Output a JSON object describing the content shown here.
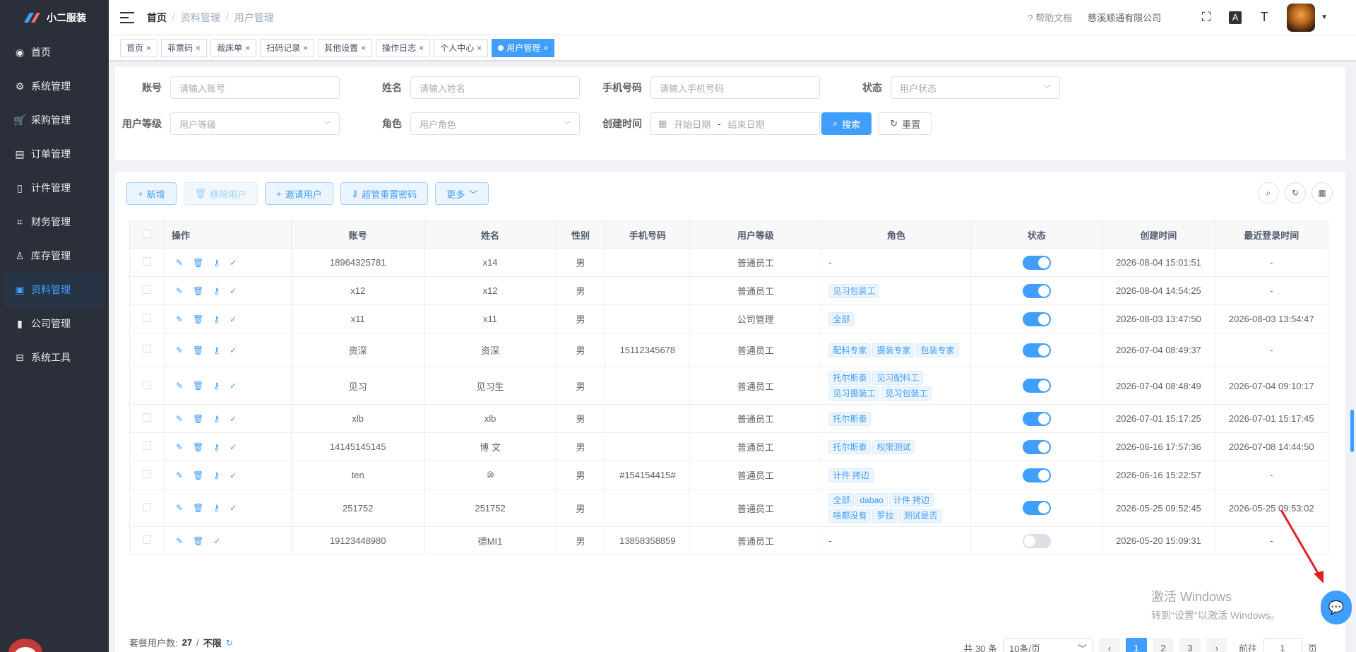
{
  "app": {
    "title": "小二服装"
  },
  "sidebar": {
    "items": [
      {
        "label": "首页",
        "icon": "dashboard-icon"
      },
      {
        "label": "系统管理",
        "icon": "gear-icon"
      },
      {
        "label": "采购管理",
        "icon": "cart-icon"
      },
      {
        "label": "订单管理",
        "icon": "order-icon"
      },
      {
        "label": "计件管理",
        "icon": "book-icon"
      },
      {
        "label": "财务管理",
        "icon": "finance-icon"
      },
      {
        "label": "库存管理",
        "icon": "user-icon"
      },
      {
        "label": "资料管理",
        "icon": "document-icon"
      },
      {
        "label": "公司管理",
        "icon": "chart-icon"
      },
      {
        "label": "系统工具",
        "icon": "toolbox-icon"
      }
    ]
  },
  "navbar": {
    "breadcrumb": [
      "首页",
      "资料管理",
      "用户管理"
    ],
    "help": "帮助文档",
    "company": "慈溪顺通有限公司"
  },
  "tags": [
    {
      "label": "首页"
    },
    {
      "label": "菲票码"
    },
    {
      "label": "裁床单"
    },
    {
      "label": "扫码记录"
    },
    {
      "label": "其他设置"
    },
    {
      "label": "操作日志"
    },
    {
      "label": "个人中心"
    },
    {
      "label": "用户管理"
    }
  ],
  "search": {
    "account_label": "账号",
    "account_placeholder": "请输入账号",
    "name_label": "姓名",
    "name_placeholder": "请输入姓名",
    "phone_label": "手机号码",
    "phone_placeholder": "请输入手机号码",
    "status_label": "状态",
    "status_placeholder": "用户状态",
    "level_label": "用户等级",
    "level_placeholder": "用户等级",
    "role_label": "角色",
    "role_placeholder": "用户角色",
    "created_label": "创建时间",
    "start_placeholder": "开始日期",
    "end_placeholder": "结束日期",
    "range_sep": "-",
    "search_btn": "搜索",
    "reset_btn": "重置"
  },
  "toolbar": {
    "add": "新增",
    "remove": "移除用户",
    "invite": "邀请用户",
    "reset_pwd": "超管重置密码",
    "more": "更多"
  },
  "table": {
    "headers": [
      "操作",
      "账号",
      "姓名",
      "性别",
      "手机号码",
      "用户等级",
      "角色",
      "状态",
      "创建时间",
      "最近登录时间"
    ],
    "rows": [
      {
        "account": "18964325781",
        "name": "x14",
        "gender": "男",
        "phone": "",
        "level": "普通员工",
        "roles": [],
        "role_text": "-",
        "on": true,
        "created": "2026-08-04 15:01:51",
        "last": "-"
      },
      {
        "account": "x12",
        "name": "x12",
        "gender": "男",
        "phone": "",
        "level": "普通员工",
        "roles": [
          "见习包装工"
        ],
        "on": true,
        "created": "2026-08-04 14:54:25",
        "last": "-"
      },
      {
        "account": "x11",
        "name": "x11",
        "gender": "男",
        "phone": "",
        "level": "公司管理",
        "roles": [
          "全部"
        ],
        "on": true,
        "created": "2026-08-03 13:47:50",
        "last": "2026-08-03 13:54:47"
      },
      {
        "account": "资深",
        "name": "资深",
        "gender": "男",
        "phone": "15112345678",
        "level": "普通员工",
        "roles": [
          "配料专家",
          "摄装专家",
          "包装专家"
        ],
        "on": true,
        "created": "2026-07-04 08:49:37",
        "last": "-"
      },
      {
        "account": "见习",
        "name": "见习生",
        "gender": "男",
        "phone": "",
        "level": "普通员工",
        "roles": [
          "托尔斯泰",
          "见习配料工",
          "见习摄装工",
          "见习包装工"
        ],
        "on": true,
        "created": "2026-07-04 08:48:49",
        "last": "2026-07-04 09:10:17"
      },
      {
        "account": "xlb",
        "name": "xlb",
        "gender": "男",
        "phone": "",
        "level": "普通员工",
        "roles": [
          "托尔斯泰"
        ],
        "on": true,
        "created": "2026-07-01 15:17:25",
        "last": "2026-07-01 15:17:45"
      },
      {
        "account": "14145145145",
        "name": "博 文",
        "gender": "男",
        "phone": "",
        "level": "普通员工",
        "roles": [
          "托尔斯泰",
          "权限测试"
        ],
        "on": true,
        "created": "2026-06-16 17:57:36",
        "last": "2026-07-08 14:44:50"
      },
      {
        "account": "ten",
        "name": "⑩",
        "gender": "男",
        "phone": "#154154415#",
        "level": "普通员工",
        "roles": [
          "计件 拷边"
        ],
        "on": true,
        "created": "2026-06-16 15:22:57",
        "last": "-"
      },
      {
        "account": "251752",
        "name": "251752",
        "gender": "男",
        "phone": "",
        "level": "普通员工",
        "roles": [
          "全部",
          "dabao",
          "计件 拷边",
          "啥都没有",
          "罗拉",
          "测试是否"
        ],
        "on": true,
        "created": "2026-05-25 09:52:45",
        "last": "2026-05-25 09:53:02"
      },
      {
        "account": "19123448980",
        "name": "德MI1",
        "gender": "男",
        "phone": "13858358859",
        "level": "普通员工",
        "roles": [],
        "role_text": "-",
        "on": false,
        "created": "2026-05-20 15:09:31",
        "last": "-"
      }
    ]
  },
  "footer": {
    "quota_label": "套餐用户数:",
    "quota_value": "27",
    "quota_sep": "/",
    "quota_limit": "不限",
    "total": "共 30 条",
    "page_size": "10条/页",
    "pages": [
      "1",
      "2",
      "3"
    ],
    "goto_label": "前往",
    "goto_value": "1",
    "page_unit": "页"
  },
  "watermark": {
    "title": "激活 Windows",
    "sub": "转到\"设置\"以激活 Windows。"
  },
  "colors": {
    "primary": "#409eff",
    "sidebar_bg": "#2b2f3a"
  }
}
